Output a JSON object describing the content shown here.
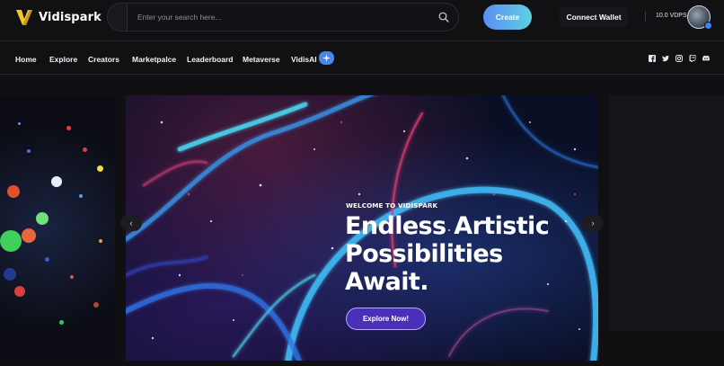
{
  "brand": {
    "name": "Vidispark"
  },
  "search": {
    "placeholder": "Enter your search here..."
  },
  "header": {
    "create_label": "Create",
    "connect_label": "Connect Wallet",
    "balance": "10.0 VDPS"
  },
  "nav": {
    "items": [
      "Home",
      "Explore",
      "Creators",
      "Marketpalce",
      "Leaderboard",
      "Metaverse",
      "VidisAI"
    ],
    "socials": [
      "facebook-icon",
      "twitter-icon",
      "instagram-icon",
      "twitch-icon",
      "discord-icon"
    ]
  },
  "hero": {
    "eyebrow": "WELCOME TO VIDISPARK",
    "title_line1": "Endless Artistic",
    "title_line2": "Possibilities",
    "title_line3": "Await.",
    "cta_label": "Explore Now!"
  },
  "colors": {
    "accent_gradient_start": "#5a8ef7",
    "accent_gradient_end": "#5fd0e0",
    "cta_fill": "#4a2fb8",
    "logo_yellow": "#f4c531"
  }
}
